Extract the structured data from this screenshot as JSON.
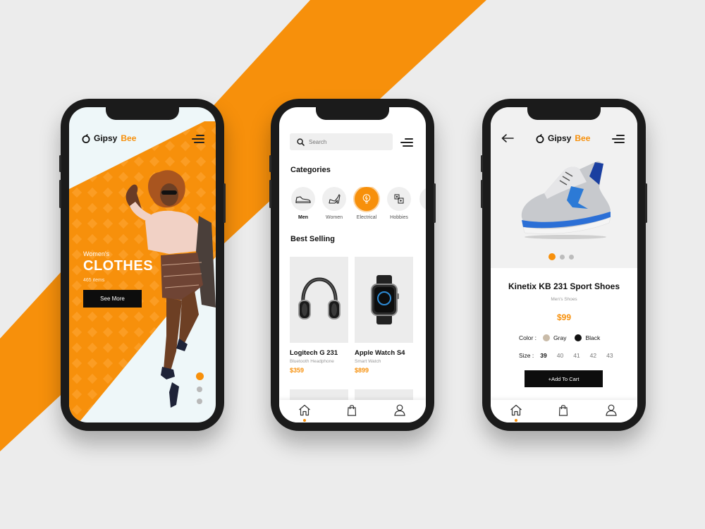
{
  "brand": {
    "name_a": "Gipsy",
    "name_b": "Bee"
  },
  "colors": {
    "accent": "#f7900b",
    "dark": "#0d0d0d",
    "background": "#ececec"
  },
  "hero": {
    "subtitle": "Women's",
    "title": "CLOTHES",
    "count": "465 items",
    "button": "See More",
    "pager": {
      "pages": 3,
      "active": 1
    }
  },
  "shop": {
    "search_placeholder": "Search",
    "categories_title": "Categories",
    "categories": [
      {
        "label": "Men",
        "icon": "sneaker-icon",
        "active": false
      },
      {
        "label": "Women",
        "icon": "heel-icon",
        "active": false
      },
      {
        "label": "Electrical",
        "icon": "lightbulb-icon",
        "active": true
      },
      {
        "label": "Hobbies",
        "icon": "hobbies-icon",
        "active": false
      }
    ],
    "best_selling_title": "Best Selling",
    "products": [
      {
        "name": "Logitech G 231",
        "subtitle": "Bluetooth Headphone",
        "price": "$359",
        "icon": "headphones-icon"
      },
      {
        "name": "Apple Watch S4",
        "subtitle": "Smart Watch",
        "price": "$899",
        "icon": "smartwatch-icon"
      }
    ]
  },
  "detail": {
    "name": "Kinetix KB 231 Sport Shoes",
    "category": "Men's Shoes",
    "price": "$99",
    "color_label": "Color :",
    "colors": [
      {
        "name": "Gray",
        "hex": "#c9bba8"
      },
      {
        "name": "Black",
        "hex": "#111111"
      }
    ],
    "size_label": "Size :",
    "sizes": [
      "39",
      "40",
      "41",
      "42",
      "43"
    ],
    "selected_size": "39",
    "cart_button": "+Add To Cart",
    "pager": {
      "pages": 3,
      "active": 1
    }
  },
  "tabbar": {
    "icons": [
      "home-icon",
      "bag-icon",
      "user-icon"
    ],
    "active": "home-icon"
  }
}
